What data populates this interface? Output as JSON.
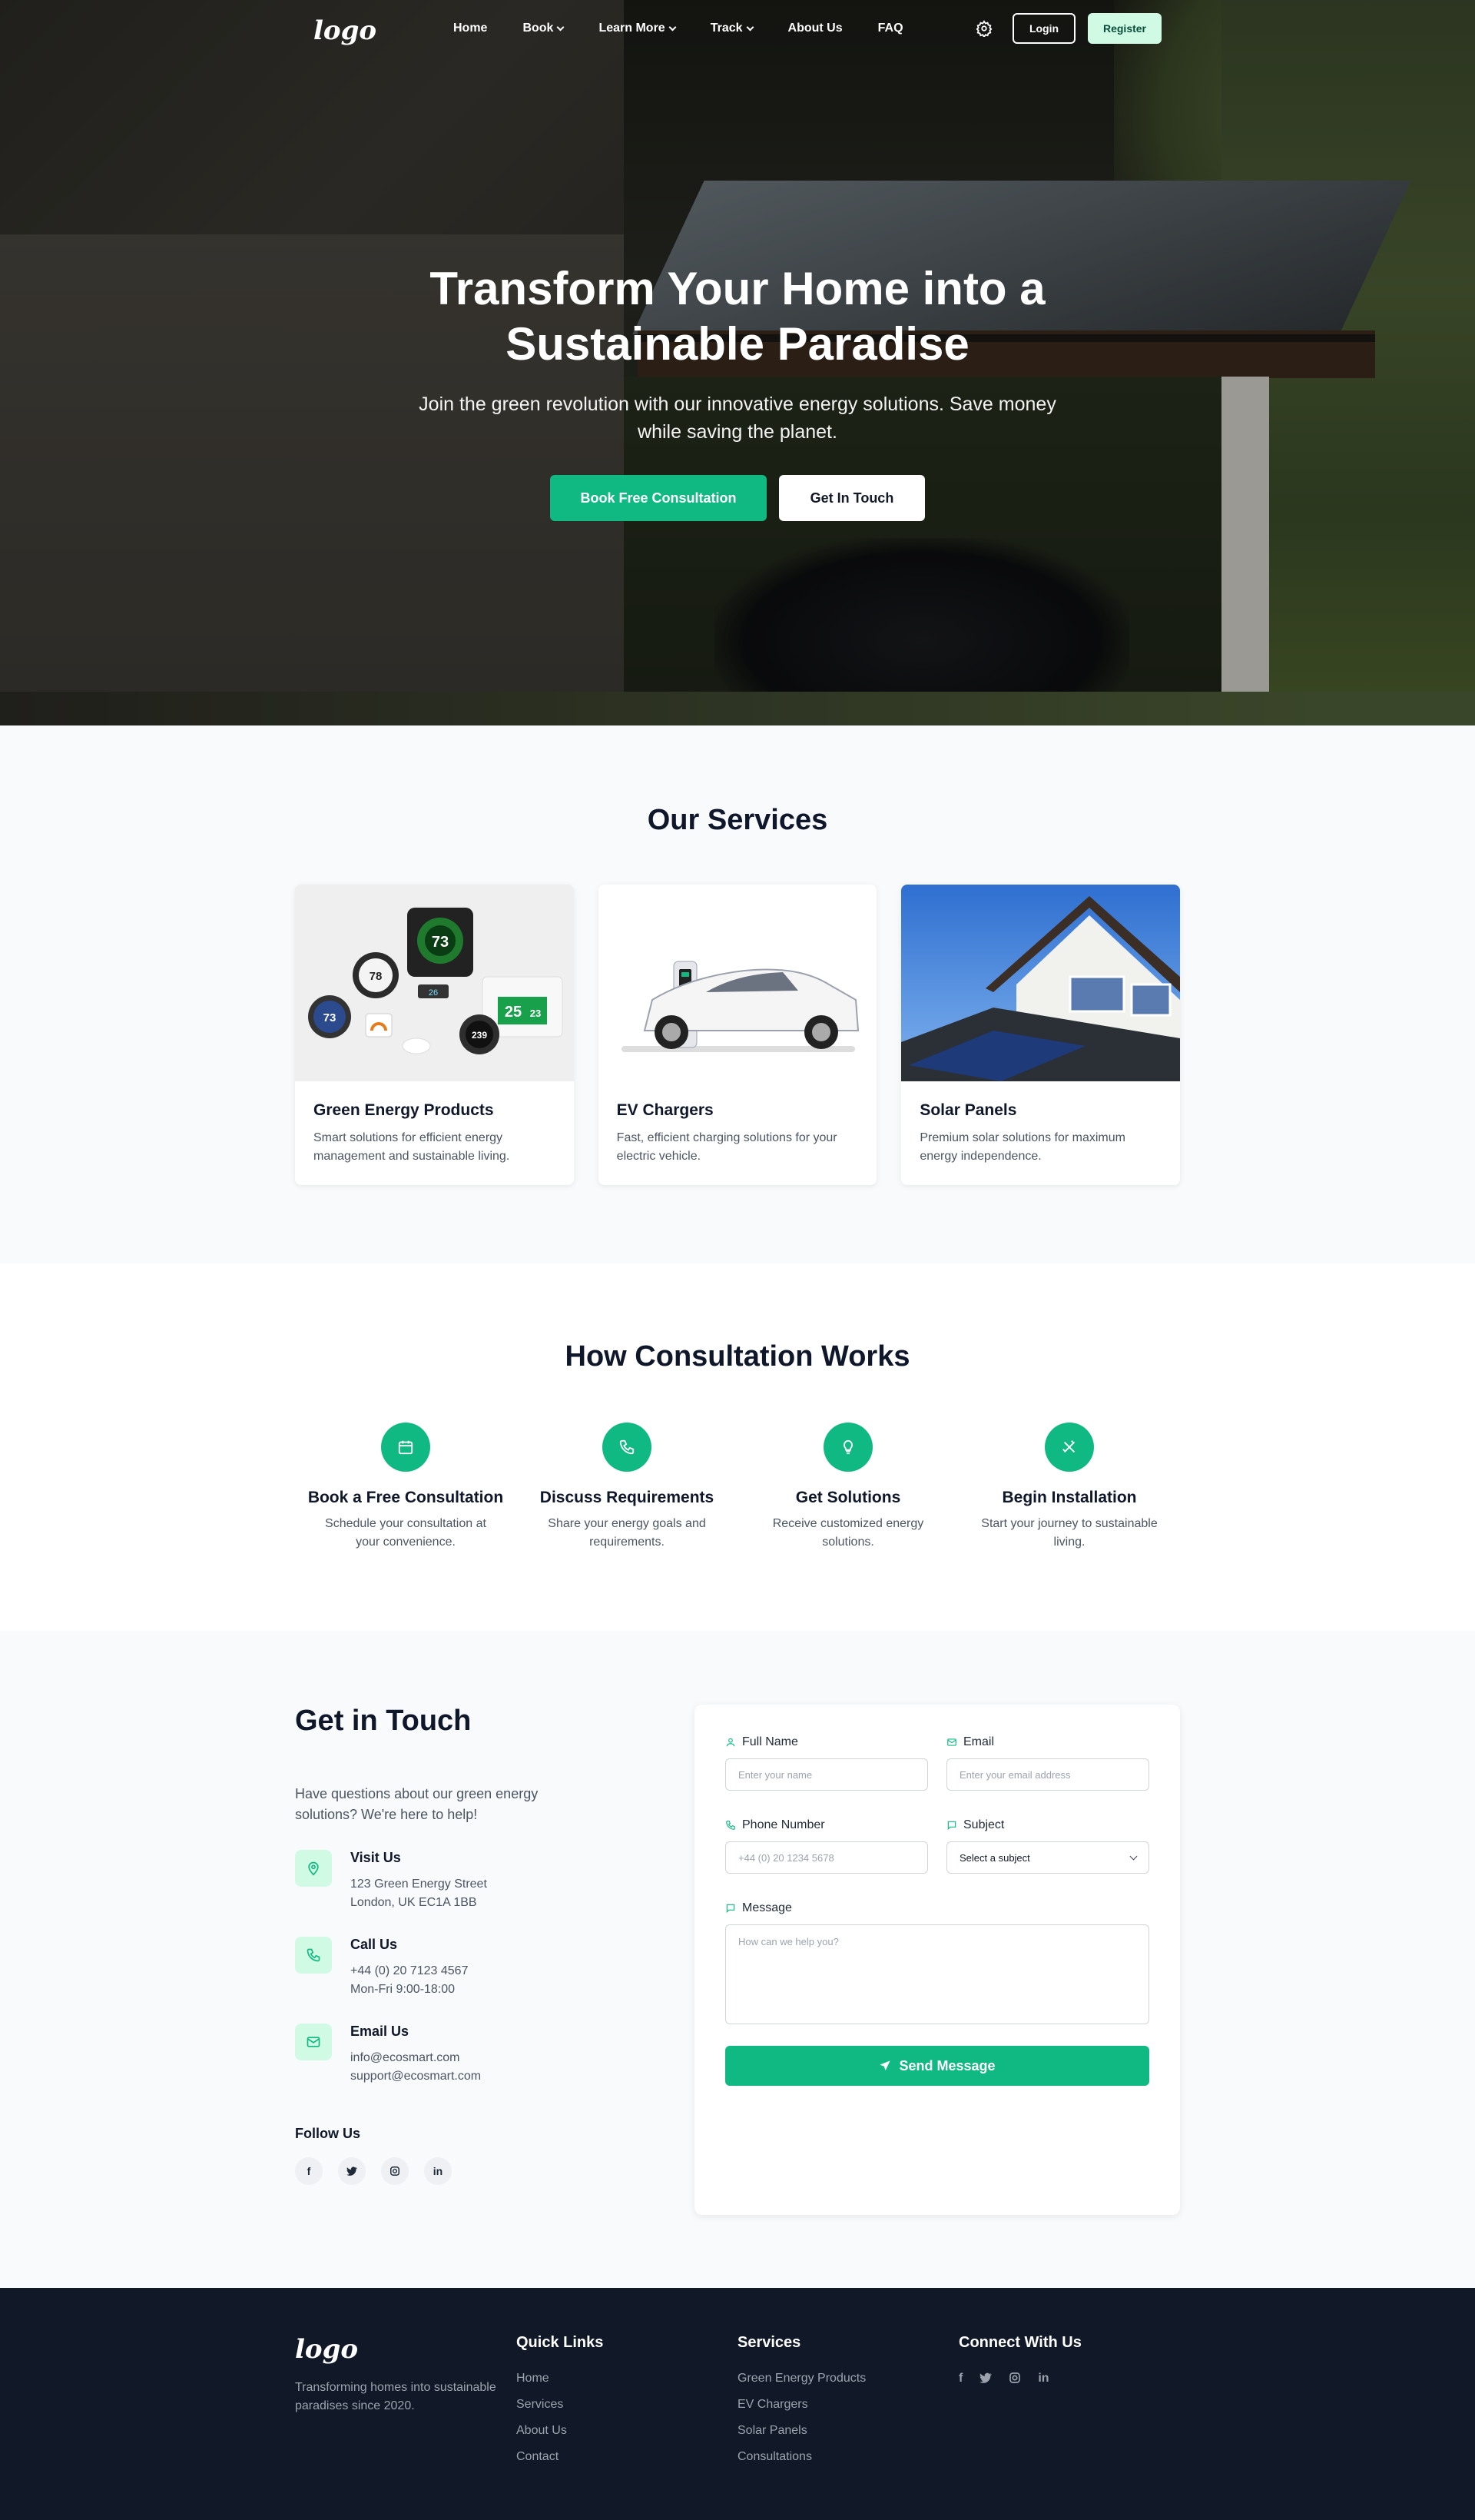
{
  "nav": {
    "logo": "logo",
    "items": [
      {
        "label": "Home",
        "dropdown": false
      },
      {
        "label": "Book",
        "dropdown": true
      },
      {
        "label": "Learn More",
        "dropdown": true
      },
      {
        "label": "Track",
        "dropdown": true
      },
      {
        "label": "About Us",
        "dropdown": false
      },
      {
        "label": "FAQ",
        "dropdown": false
      }
    ],
    "settings_icon": "gear-icon",
    "login_label": "Login",
    "register_label": "Register"
  },
  "hero": {
    "title": "Transform Your Home into a Sustainable Paradise",
    "subtitle": "Join the green revolution with our innovative energy solutions. Save money while saving the planet.",
    "primary_button": "Book Free Consultation",
    "secondary_button": "Get In Touch"
  },
  "services": {
    "title": "Our Services",
    "cards": [
      {
        "title": "Green Energy Products",
        "description": "Smart solutions for efficient energy management and sustainable living.",
        "image_readings": [
          "73",
          "78",
          "73",
          "25",
          "23",
          "239",
          "26"
        ]
      },
      {
        "title": "EV Chargers",
        "description": "Fast, efficient charging solutions for your electric vehicle."
      },
      {
        "title": "Solar Panels",
        "description": "Premium solar solutions for maximum energy independence."
      }
    ]
  },
  "how": {
    "title": "How Consultation Works",
    "steps": [
      {
        "icon": "calendar-icon",
        "title": "Book a Free Consultation",
        "description": "Schedule your consultation at your convenience."
      },
      {
        "icon": "phone-icon",
        "title": "Discuss Requirements",
        "description": "Share your energy goals and requirements."
      },
      {
        "icon": "lightbulb-icon",
        "title": "Get Solutions",
        "description": "Receive customized energy solutions."
      },
      {
        "icon": "tools-icon",
        "title": "Begin Installation",
        "description": "Start your journey to sustainable living."
      }
    ]
  },
  "contact": {
    "title": "Get in Touch",
    "intro": "Have questions about our green energy solutions? We're here to help!",
    "visit": {
      "title": "Visit Us",
      "line1": "123 Green Energy Street",
      "line2": "London, UK EC1A 1BB"
    },
    "call": {
      "title": "Call Us",
      "line1": "+44 (0) 20 7123 4567",
      "line2": "Mon-Fri 9:00-18:00"
    },
    "email": {
      "title": "Email Us",
      "line1": "info@ecosmart.com",
      "line2": "support@ecosmart.com"
    },
    "follow_title": "Follow Us",
    "socials": [
      "f",
      "t",
      "ig",
      "in"
    ],
    "form": {
      "full_name_label": "Full Name",
      "full_name_placeholder": "Enter your name",
      "email_label": "Email",
      "email_placeholder": "Enter your email address",
      "phone_label": "Phone Number",
      "phone_placeholder": "+44 (0) 20 1234 5678",
      "subject_label": "Subject",
      "subject_value": "Select a subject",
      "message_label": "Message",
      "message_placeholder": "How can we help you?",
      "send_label": "Send Message"
    }
  },
  "footer": {
    "logo": "logo",
    "tagline": "Transforming homes into sustainable paradises since 2020.",
    "quick_links_title": "Quick Links",
    "quick_links": [
      "Home",
      "Services",
      "About Us",
      "Contact"
    ],
    "services_title": "Services",
    "services": [
      "Green Energy Products",
      "EV Chargers",
      "Solar Panels",
      "Consultations"
    ],
    "connect_title": "Connect With Us"
  },
  "colors": {
    "accent": "#10b981",
    "dark": "#111827",
    "light_bg": "#f8fafc"
  }
}
